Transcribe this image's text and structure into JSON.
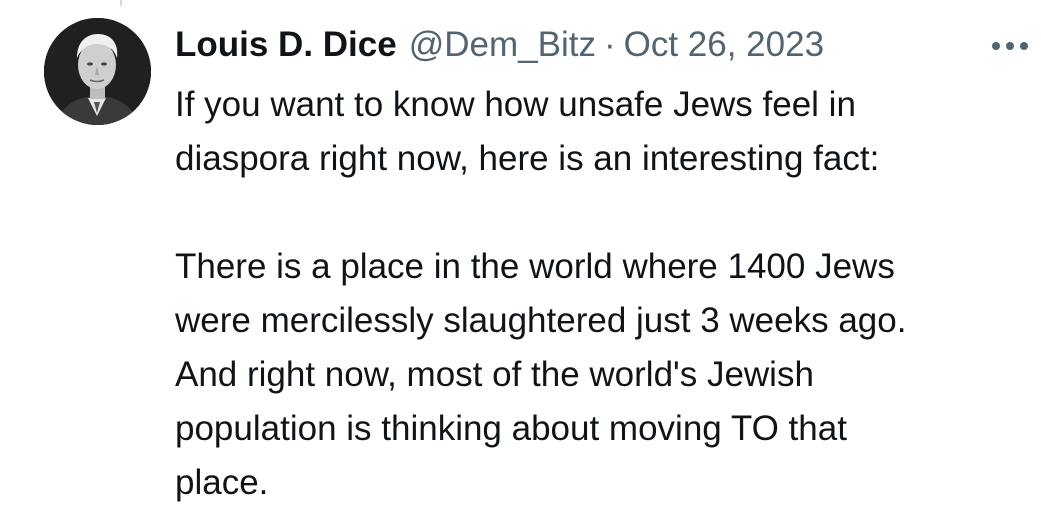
{
  "tweet": {
    "author": {
      "display_name": "Louis D. Dice",
      "handle": "@Dem_Bitz",
      "avatar_icon": "profile-photo"
    },
    "separator": "·",
    "date": "Oct 26, 2023",
    "more_icon": "more-horizontal-icon",
    "text": {
      "paragraph_1": [
        "If you want to know how unsafe Jews feel in",
        "diaspora right now, here is an interesting fact:"
      ],
      "paragraph_2": [
        "There is a place in the world where 1400 Jews",
        "were mercilessly slaughtered just 3 weeks ago.",
        "And right now, most of the world's Jewish",
        "population is thinking about moving TO that",
        "place."
      ]
    },
    "colors": {
      "text": "#0f1419",
      "secondary": "#536471",
      "background": "#ffffff"
    }
  }
}
